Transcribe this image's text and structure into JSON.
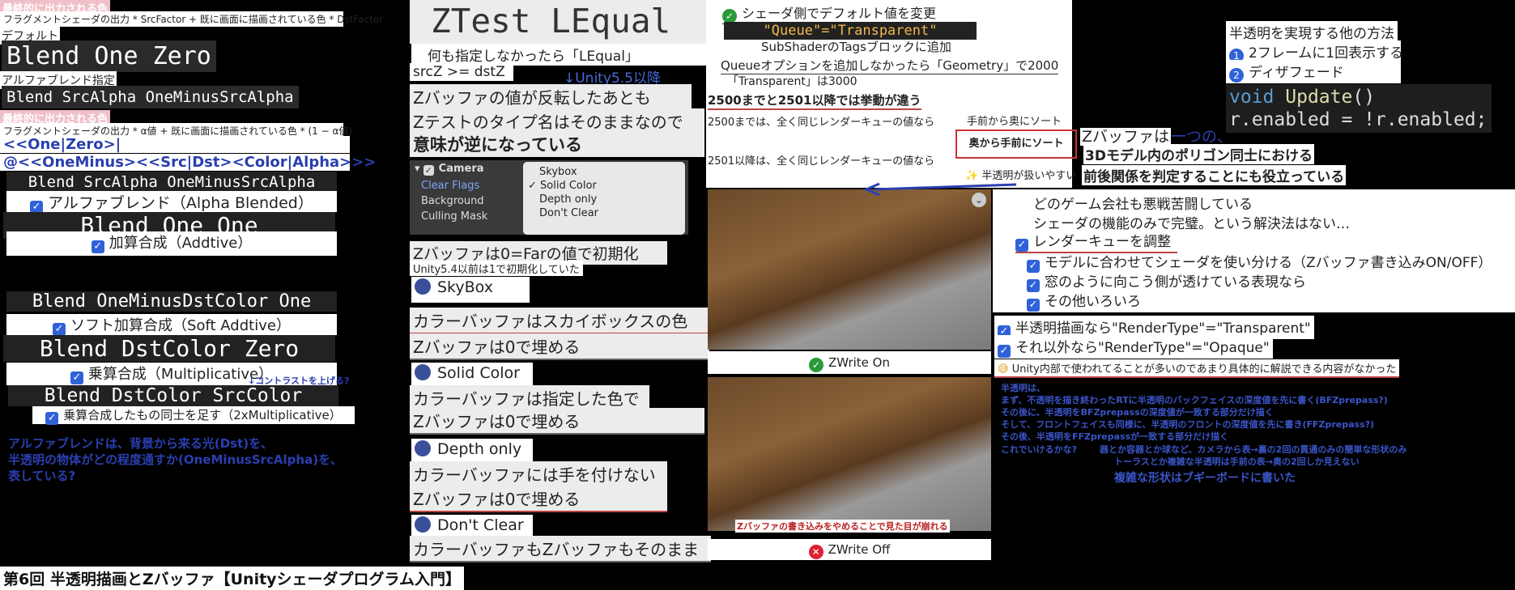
{
  "footer": {
    "title": "第6回 半透明描画とZバッファ【Unityシェーダプログラム入門】"
  },
  "col1": {
    "final_output_1": "最終的に出力される色",
    "formula_1": "フラグメントシェーダの出力 * SrcFactor + 既に画面に描画されている色 * DstFactor",
    "default_label": "デフォルト",
    "blend_one_zero": "Blend One Zero",
    "alpha_blend_label": "アルファブレンド指定",
    "blend_srcalpha": "Blend SrcAlpha OneMinusSrcAlpha",
    "final_output_2": "最終的に出力される色",
    "formula_2": "フラグメントシェーダの出力 * α値 + 既に画面に描画されている色 * (1 − α値)",
    "grammar_1": "<<One|Zero>|",
    "grammar_2": "@<<OneMinus><<Src|Dst><Color|Alpha>>>",
    "blend_srcalpha_2": "Blend SrcAlpha OneMinusSrcAlpha",
    "alpha_blended": "アルファブレンド（Alpha Blended）",
    "blend_one_one": "Blend One One",
    "additive": "加算合成（Addtive）",
    "blend_oneminus_dst": "Blend OneMinusDstColor One",
    "soft_additive": "ソフト加算合成（Soft Addtive）",
    "blend_dst_zero": "Blend DstColor Zero",
    "multiplicative": "乗算合成（Multiplicative）",
    "contrast_note": "↓コントラストを上げる?",
    "blend_dst_src": "Blend DstColor SrcColor",
    "multiplicative2": "乗算合成したもの同士を足す（2xMultiplicative）",
    "note_1": "アルファブレンドは、背景から来る光(Dst)を、",
    "note_2": "半透明の物体がどの程度通すか(OneMinusSrcAlpha)を、",
    "note_3": "表している?"
  },
  "col2": {
    "ztest": "ZTest LEqual",
    "nothing": "何も指定しなかったら「LEqual」",
    "srcz": "srcZ >= dstZ",
    "unity55": "↓Unity5.5以降",
    "reversed": "Zバッファの値が反転したあとも",
    "typename": "Zテストのタイプ名はそのままなので",
    "opposite": "意味が逆になっている",
    "camera_label": "Camera",
    "clear_flags": "Clear Flags",
    "background": "Background",
    "culling_mask": "Culling Mask",
    "menu": [
      "Skybox",
      "Solid Color",
      "Depth only",
      "Don't Clear"
    ],
    "menu_selected": "Solid Color",
    "zinit": "Zバッファは0=Farの値で初期化",
    "unity54": "Unity5.4以前は1で初期化していた",
    "skybox": "SkyBox",
    "skybox_c": "カラーバッファはスカイボックスの色",
    "skybox_z": "Zバッファは0で埋める",
    "solid": "Solid Color",
    "solid_c": "カラーバッファは指定した色で",
    "solid_z": "Zバッファは0で埋める",
    "depth": "Depth only",
    "depth_c": "カラーバッファには手を付けない",
    "depth_z": "Zバッファは0で埋める",
    "dontclear": "Don't Clear",
    "dontclear_c": "カラーバッファもZバッファもそのまま"
  },
  "col3": {
    "shader_default": "シェーダ側でデフォルト値を変更",
    "queue_code": "\"Queue\"=\"Transparent\"",
    "subshader": "SubShaderのTagsブロックに追加",
    "queue_option": "Queueオプションを追加しなかったら「Geometry」で2000",
    "transparent_3000": "「Transparent」は3000",
    "behavior_diff": "2500までと2501以降では挙動が違う",
    "until_2500": "2500までは、全く同じレンダーキューの値なら",
    "front_to_back": "手前から奥にソート",
    "from_2501": "2501以降は、全く同じレンダーキューの値なら",
    "back_to_front": "奥から手前にソート",
    "semitransparent_handle": "半透明が扱いやすい",
    "zwrite_on": "ZWrite On",
    "zwrite_off_caption": "Zバッファの書き込みをやめることで見た目が崩れる",
    "zwrite_off": "ZWrite Off"
  },
  "col4": {
    "other_methods": "半透明を実現する他の方法",
    "method1": "2フレームに1回表示する",
    "method2": "ディザフェード",
    "code1": "void Update()",
    "code2": "r.enabled = !r.enabled;",
    "zbuf1": "Zバッファは",
    "zbuf1b": "一つの、",
    "zbuf2": "3Dモデル内のポリゴン同士における",
    "zbuf3": "前後関係を判定することにも役立っている",
    "struggle": "どのゲーム会社も悪戦苦闘している",
    "no_solution": "シェーダの機能のみで完璧。という解決法はない…",
    "opt1": "レンダーキューを調整",
    "opt2": "モデルに合わせてシェーダを使い分ける（Zバッファ書き込みON/OFF）",
    "opt3": "窓のように向こう側が透けている表現なら",
    "opt4": "その他いろいろ",
    "rt_trans": "半透明描画なら\"RenderType\"=\"Transparent\"",
    "rt_opaque": "それ以外なら\"RenderType\"=\"Opaque\"",
    "internal": "Unity内部で使われてることが多いのであまり具体的に解説できる内容がなかった",
    "notes": [
      "半透明は、",
      "まず、不透明を描き終わったRTに半透明のバックフェイスの深度値を先に書く(BFZprepass?)",
      "その後に、半透明をBFZprepassの深度値が一致する部分だけ描く",
      "そして、フロントフェイスも同様に、半透明のフロントの深度値を先に書き(FFZprepass?)",
      "その後、半透明をFFZprepassが一致する部分だけ描く"
    ],
    "note_a": "これでいけるかな?",
    "note_b": "器とか容器とか球など、カメラから表→裏の2回の貫通のみの簡単な形状のみ",
    "note_c": "トーラスとか複雑な半透明は手前の表→奥の2回しか見えない",
    "note_d": "複雑な形状はブギーボードに書いた"
  }
}
